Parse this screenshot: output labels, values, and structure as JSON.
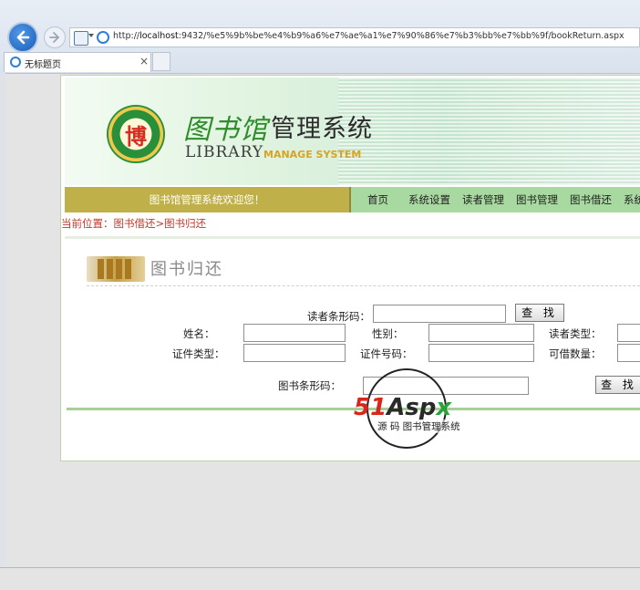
{
  "browser": {
    "url_prefix": "http://",
    "url_host": "localhost",
    "url_rest": ":9432/%e5%9b%be%e4%b9%a6%e7%ae%a1%e7%90%86%e7%b3%bb%e7%bb%9f/bookReturn.aspx",
    "tab_title": "无标题页",
    "tab_close": "×"
  },
  "banner": {
    "seal_char": "博",
    "title_cn_art": "图书馆",
    "title_cn": "管理系统",
    "title_en_1": "LIBRARY",
    "title_en_2": "MANAGE SYSTEM"
  },
  "nav": {
    "welcome": "图书馆管理系统欢迎您！",
    "links": [
      "首页",
      "系统设置",
      "读者管理",
      "图书管理",
      "图书借还",
      "系统"
    ]
  },
  "breadcrumb": "当前位置：图书借还>图书归还",
  "section_title": "图书归还",
  "form": {
    "reader_barcode_label": "读者条形码：",
    "search_button": "查 找",
    "name_label": "姓名：",
    "gender_label": "性别：",
    "reader_type_label": "读者类型：",
    "id_type_label": "证件类型：",
    "id_number_label": "证件号码：",
    "borrow_limit_label": "可借数量：",
    "book_barcode_label": "图书条形码：",
    "book_search_button": "查 找",
    "values": {
      "reader_barcode": "",
      "name": "",
      "gender": "",
      "reader_type": "",
      "id_type": "",
      "id_number": "",
      "borrow_limit": "",
      "book_barcode": ""
    }
  },
  "watermark": {
    "brand_51": "51",
    "brand_asp": "Asp",
    "brand_x": "x",
    "subtitle": "源 码 图书管理系统"
  },
  "colors": {
    "welcome_bg": "#bfb04a",
    "nav_bg": "#a8d9a0",
    "breadcrumb_text": "#c0392b",
    "divider": "#a4cf96"
  }
}
